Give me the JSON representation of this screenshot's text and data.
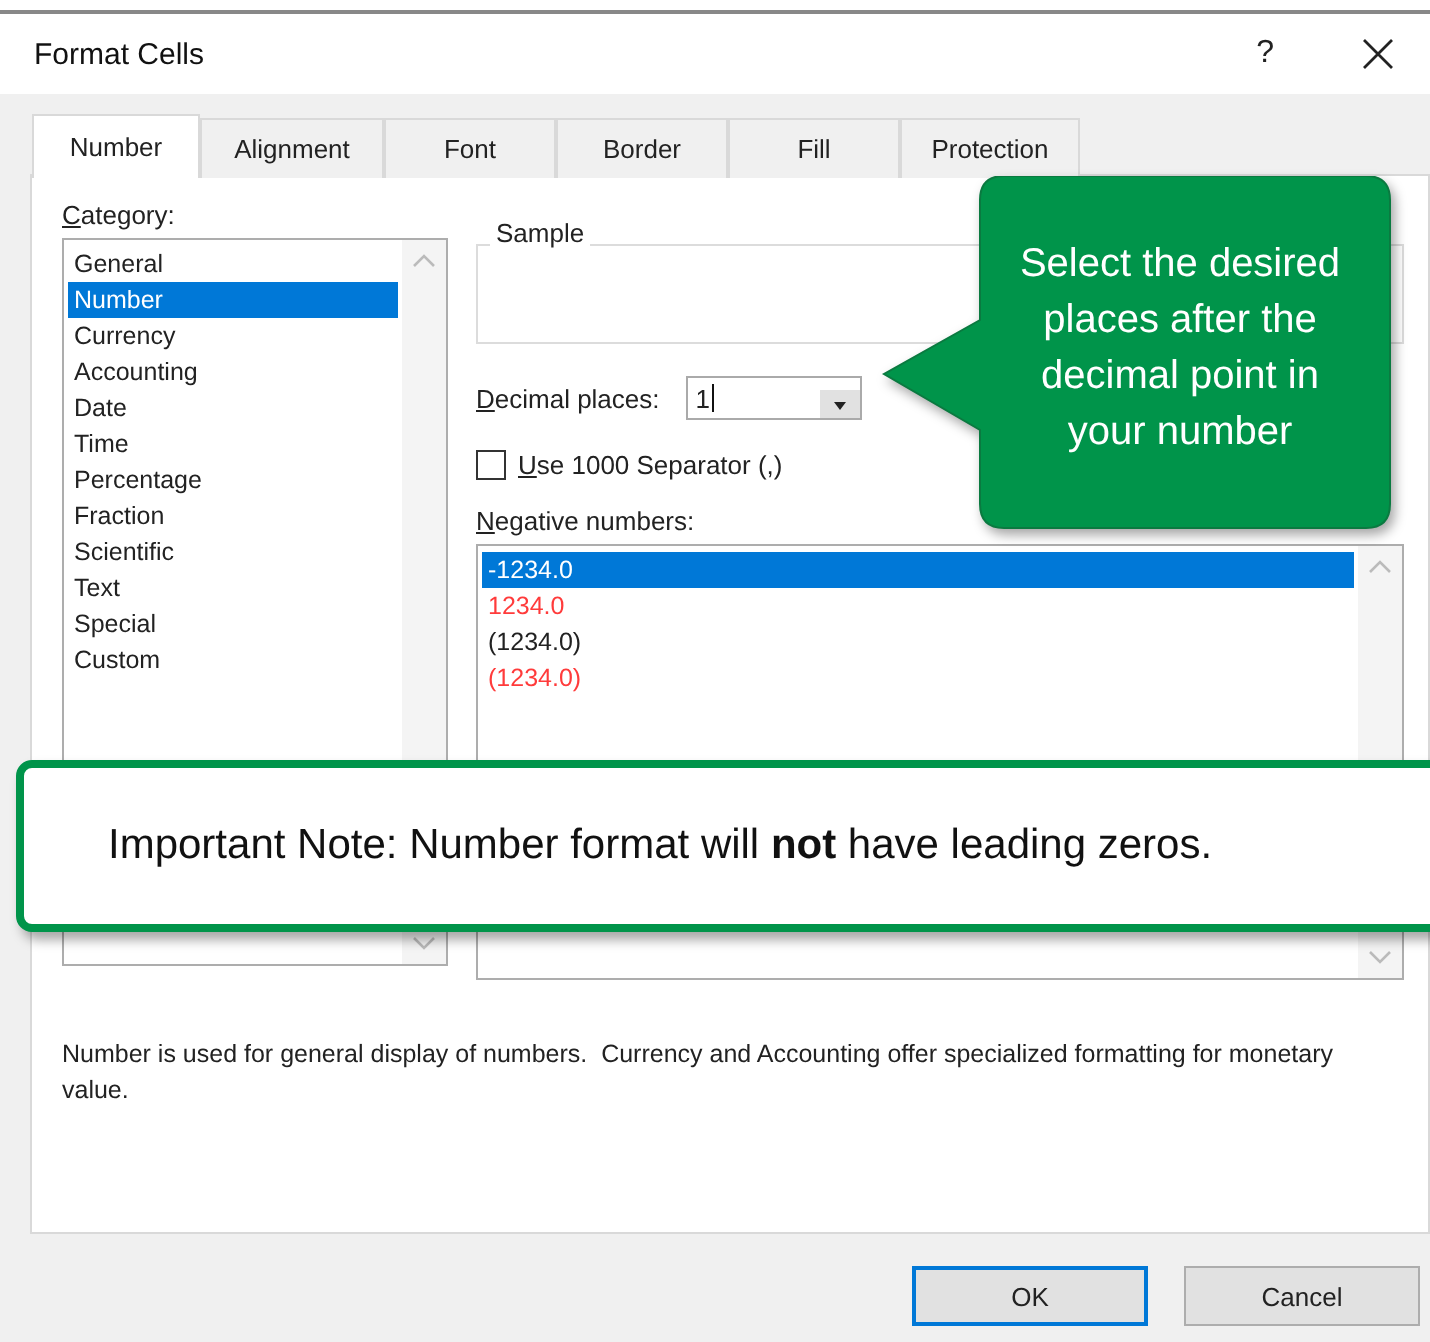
{
  "window": {
    "title": "Format Cells",
    "help": "?"
  },
  "tabs": [
    {
      "label": "Number",
      "selected": true
    },
    {
      "label": "Alignment",
      "selected": false
    },
    {
      "label": "Font",
      "selected": false
    },
    {
      "label": "Border",
      "selected": false
    },
    {
      "label": "Fill",
      "selected": false
    },
    {
      "label": "Protection",
      "selected": false
    }
  ],
  "category": {
    "label": "Category:",
    "items": [
      {
        "label": "General",
        "selected": false
      },
      {
        "label": "Number",
        "selected": true
      },
      {
        "label": "Currency",
        "selected": false
      },
      {
        "label": "Accounting",
        "selected": false
      },
      {
        "label": "Date",
        "selected": false
      },
      {
        "label": "Time",
        "selected": false
      },
      {
        "label": "Percentage",
        "selected": false
      },
      {
        "label": "Fraction",
        "selected": false
      },
      {
        "label": "Scientific",
        "selected": false
      },
      {
        "label": "Text",
        "selected": false
      },
      {
        "label": "Special",
        "selected": false
      },
      {
        "label": "Custom",
        "selected": false
      }
    ]
  },
  "sample": {
    "label": "Sample"
  },
  "decimal_places": {
    "label": "Decimal places:",
    "value": "1"
  },
  "separator": {
    "label": "Use 1000 Separator (,)",
    "checked": false
  },
  "negative_numbers": {
    "label": "Negative numbers:",
    "items": [
      {
        "text": "-1234.0",
        "selected": true,
        "red": false
      },
      {
        "text": "1234.0",
        "selected": false,
        "red": true
      },
      {
        "text": "(1234.0)",
        "selected": false,
        "red": false
      },
      {
        "text": "(1234.0)",
        "selected": false,
        "red": true
      }
    ]
  },
  "description": "Number is used for general display of numbers.  Currency and Accounting offer specialized formatting for monetary value.",
  "callout": "Select the desired places after the decimal point in your number",
  "note": "Important Note: Number format will **not** have leading zeros.",
  "buttons": [
    {
      "label": "OK",
      "default": true
    },
    {
      "label": "Cancel",
      "default": false
    }
  ]
}
